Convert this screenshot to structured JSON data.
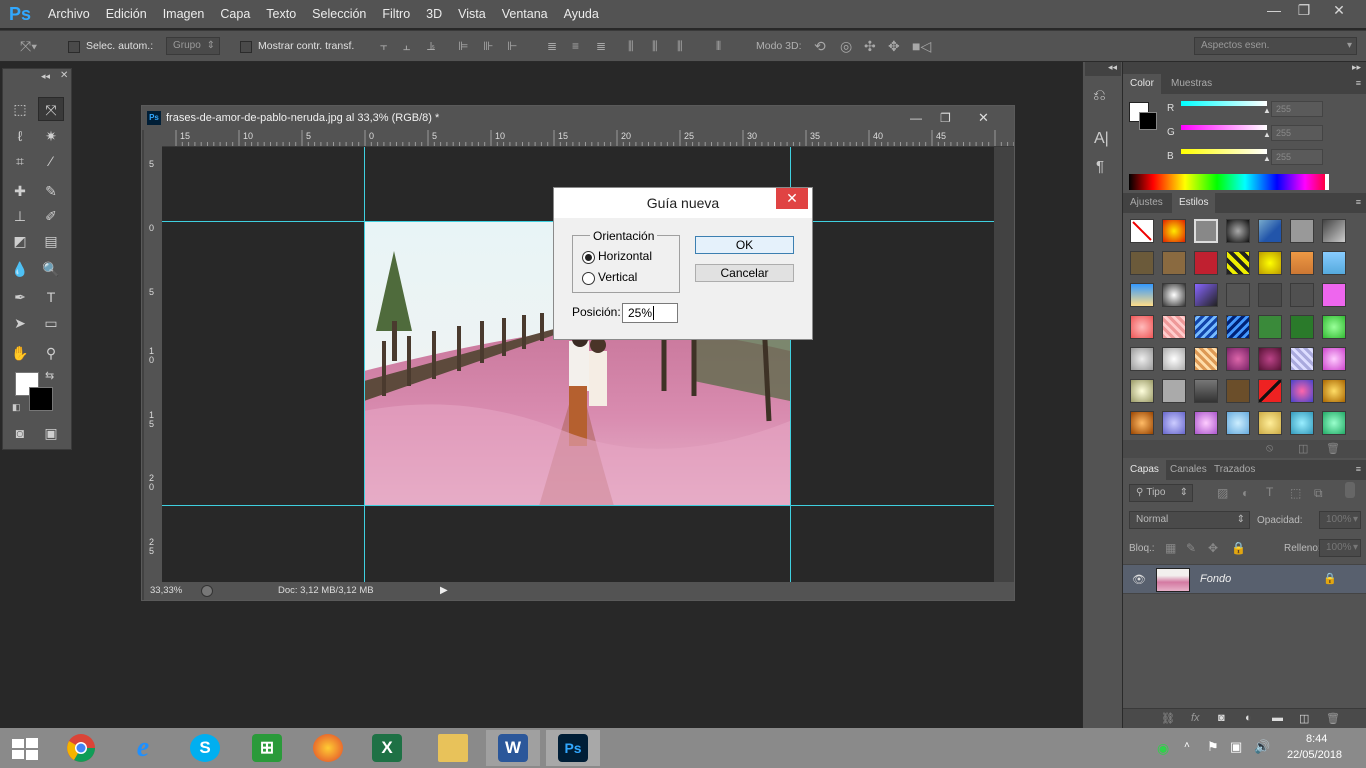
{
  "app": {
    "logo": "Ps"
  },
  "menu": [
    "Archivo",
    "Edición",
    "Imagen",
    "Capa",
    "Texto",
    "Selección",
    "Filtro",
    "3D",
    "Vista",
    "Ventana",
    "Ayuda"
  ],
  "window_controls": {
    "minimize": "—",
    "restore": "❐",
    "close": "✕"
  },
  "options": {
    "auto_select_label": "Selec. autom.:",
    "group_value": "Grupo",
    "show_transform_label": "Mostrar contr. transf.",
    "mode3d_label": "Modo 3D:",
    "workspace_value": "Aspectos esen."
  },
  "document": {
    "title": "frases-de-amor-de-pablo-neruda.jpg al 33,3% (RGB/8) *",
    "zoom": "33,33%",
    "doc_info": "Doc: 3,12 MB/3,12 MB",
    "ruler_h_labels": [
      "15",
      "10",
      "5",
      "0",
      "5",
      "10",
      "15",
      "20",
      "25",
      "30",
      "35",
      "40",
      "45"
    ],
    "ruler_v_labels": [
      "5",
      "0",
      "5",
      "1\n0",
      "1\n5",
      "2\n0",
      "2\n5"
    ]
  },
  "dialog": {
    "title": "Guía nueva",
    "close": "✕",
    "orientation_label": "Orientación",
    "horizontal_label": "Horizontal",
    "vertical_label": "Vertical",
    "selected": "horizontal",
    "position_label": "Posición:",
    "position_value": "25%",
    "ok_label": "OK",
    "cancel_label": "Cancelar"
  },
  "color_panel": {
    "tabs": [
      "Color",
      "Muestras"
    ],
    "r_label": "R",
    "g_label": "G",
    "b_label": "B",
    "r_value": "255",
    "g_value": "255",
    "b_value": "255"
  },
  "styles_panel": {
    "tabs": [
      "Ajustes",
      "Estilos"
    ]
  },
  "layers_panel": {
    "tabs": [
      "Capas",
      "Canales",
      "Trazados"
    ],
    "filter_label": "Tipo",
    "blend_mode": "Normal",
    "opacity_label": "Opacidad:",
    "opacity_value": "100%",
    "lock_label": "Bloq.:",
    "fill_label": "Relleno:",
    "fill_value": "100%",
    "layer_name": "Fondo"
  },
  "taskbar": {
    "time": "8:44",
    "date": "22/05/2018"
  }
}
